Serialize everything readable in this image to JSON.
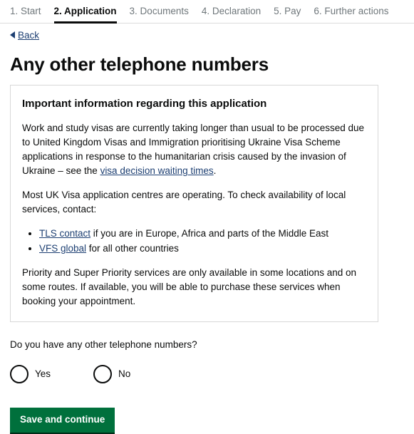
{
  "step_nav": {
    "steps": [
      {
        "label": "1. Start",
        "current": false
      },
      {
        "label": "2. Application",
        "current": true
      },
      {
        "label": "3. Documents",
        "current": false
      },
      {
        "label": "4. Declaration",
        "current": false
      },
      {
        "label": "5. Pay",
        "current": false
      },
      {
        "label": "6. Further actions",
        "current": false
      }
    ]
  },
  "back": {
    "label": "Back"
  },
  "page": {
    "title": "Any other telephone numbers"
  },
  "info_box": {
    "heading": "Important information regarding this application",
    "paragraph1_before_link": "Work and study visas are currently taking longer than usual to be processed due to United Kingdom Visas and Immigration prioritising Ukraine Visa Scheme applications in response to the humanitarian crisis caused by the invasion of Ukraine – see the ",
    "paragraph1_link": "visa decision waiting times",
    "paragraph1_after_link": ".",
    "paragraph2": "Most UK Visa application centres are operating. To check availability of local services, contact:",
    "bullets": [
      {
        "link": "TLS contact",
        "rest": " if you are in Europe, Africa and parts of the Middle East"
      },
      {
        "link": "VFS global",
        "rest": " for all other countries"
      }
    ],
    "paragraph3": "Priority and Super Priority services are only available in some locations and on some routes. If available, you will be able to purchase these services when booking your appointment."
  },
  "question": {
    "text": "Do you have any other telephone numbers?",
    "options": [
      {
        "label": "Yes",
        "selected": false
      },
      {
        "label": "No",
        "selected": false
      }
    ]
  },
  "submit": {
    "label": "Save and continue"
  },
  "colors": {
    "green_button": "#00703c",
    "link": "#1d3f72",
    "text": "#0b0c0c",
    "muted_step": "#6f777b",
    "box_border": "#d8d8d8"
  }
}
